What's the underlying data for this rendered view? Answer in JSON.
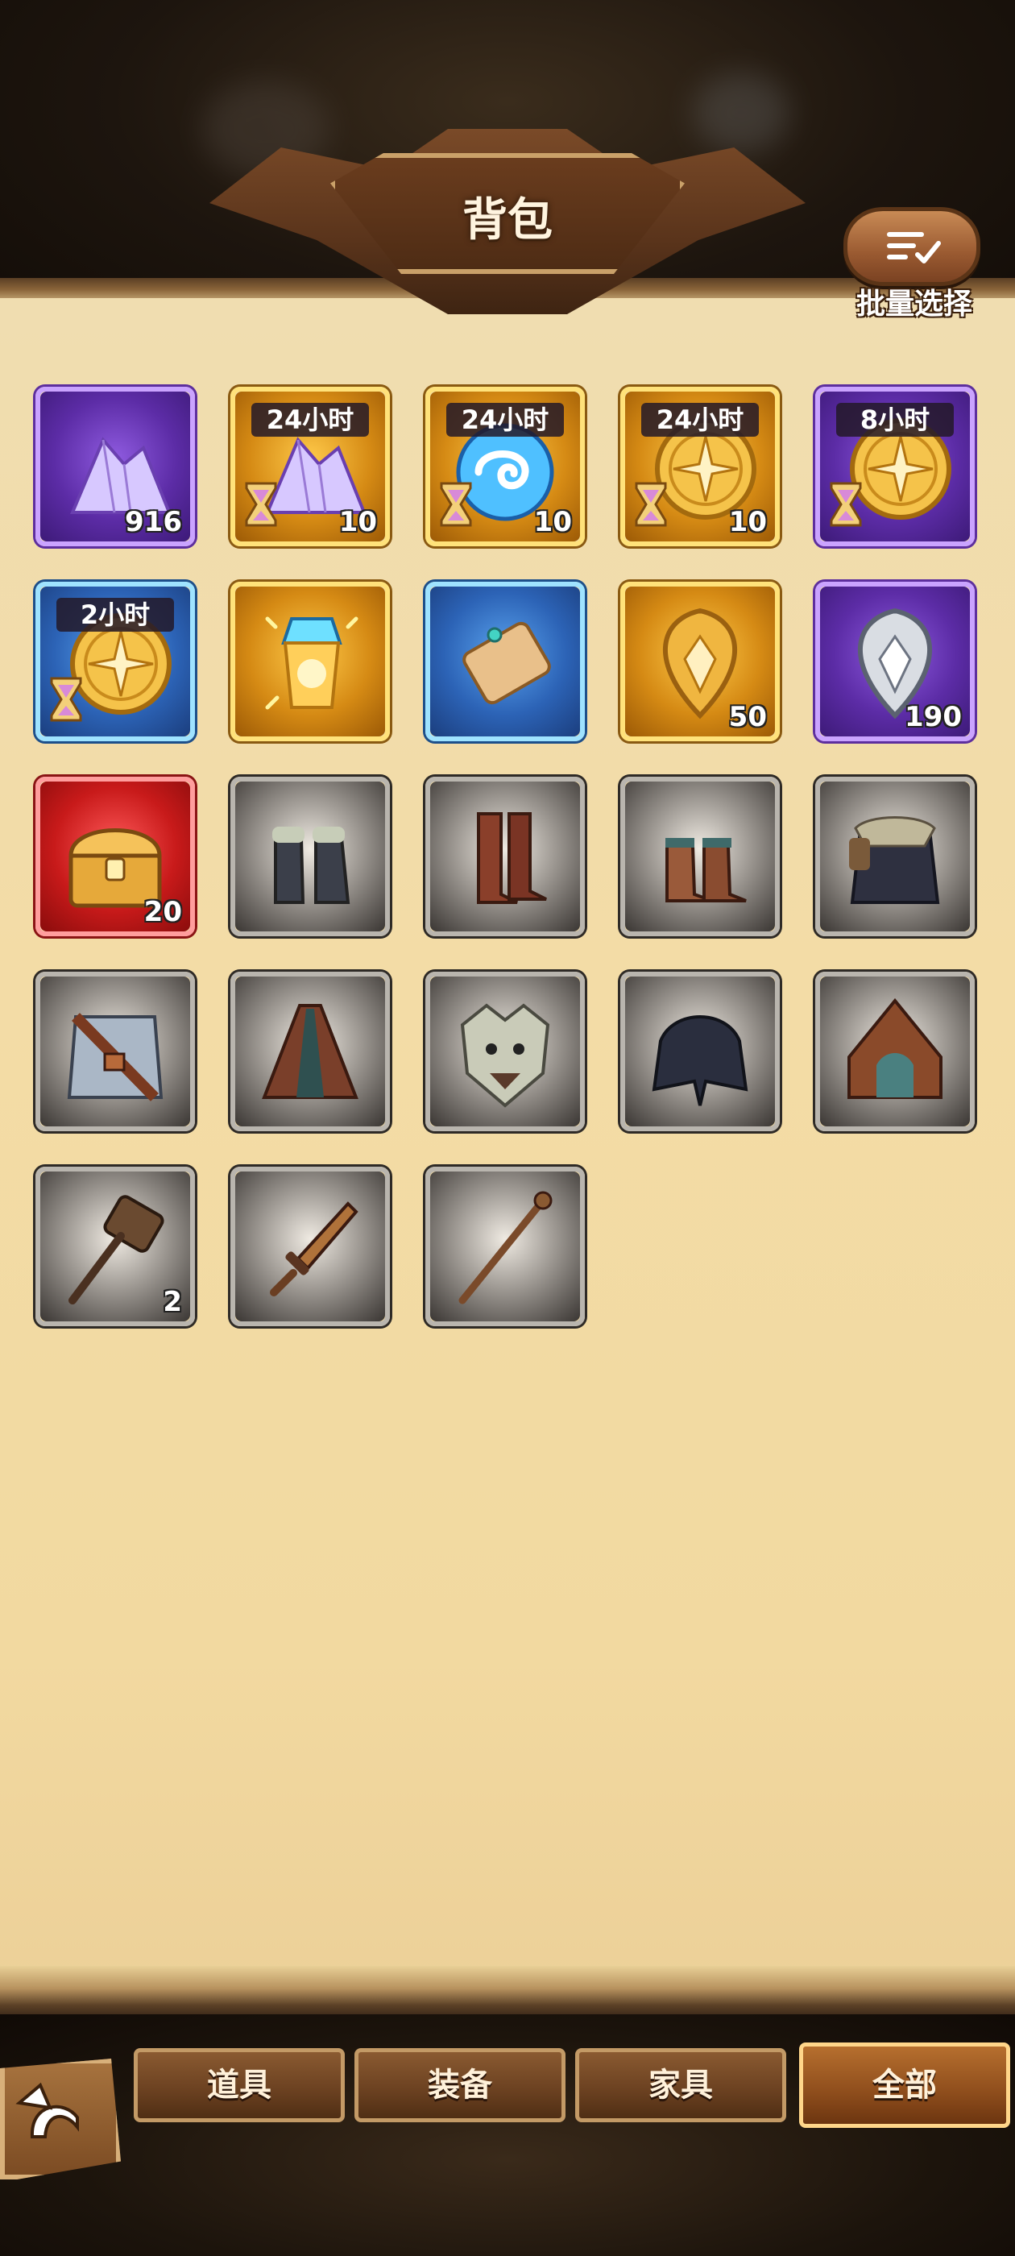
{
  "header": {
    "title": "背包",
    "batch_select_label": "批量选择"
  },
  "inventory": {
    "rows": [
      [
        {
          "name": "purple-crystal",
          "rarity": "purple",
          "timer": "",
          "qty": "916",
          "icon": "purple-crystal-icon"
        },
        {
          "name": "purple-crystal-timed",
          "rarity": "gold",
          "timer": "24小时",
          "qty": "10",
          "icon": "purple-crystal-icon"
        },
        {
          "name": "blue-orb-timed",
          "rarity": "gold",
          "timer": "24小时",
          "qty": "10",
          "icon": "blue-orb-icon"
        },
        {
          "name": "gold-coin-timed",
          "rarity": "gold",
          "timer": "24小时",
          "qty": "10",
          "icon": "gold-coin-icon"
        },
        {
          "name": "gold-coin-timed-8h",
          "rarity": "purple",
          "timer": "8小时",
          "qty": "",
          "icon": "gold-coin-icon"
        }
      ],
      [
        {
          "name": "gold-coin-timed-2h",
          "rarity": "blue",
          "timer": "2小时",
          "qty": "",
          "icon": "gold-coin-icon"
        },
        {
          "name": "magic-lantern",
          "rarity": "gold",
          "timer": "",
          "qty": "",
          "icon": "lantern-icon"
        },
        {
          "name": "scroll",
          "rarity": "blue",
          "timer": "",
          "qty": "",
          "icon": "scroll-icon"
        },
        {
          "name": "gold-crest",
          "rarity": "gold",
          "timer": "",
          "qty": "50",
          "icon": "gold-crest-icon"
        },
        {
          "name": "silver-crest",
          "rarity": "purple",
          "timer": "",
          "qty": "190",
          "icon": "silver-crest-icon"
        }
      ],
      [
        {
          "name": "treasure-chest",
          "rarity": "red",
          "timer": "",
          "qty": "20",
          "icon": "treasure-chest-icon"
        },
        {
          "name": "fur-boots",
          "rarity": "gray",
          "timer": "",
          "qty": "",
          "icon": "fur-boots-icon"
        },
        {
          "name": "tall-boots",
          "rarity": "gray",
          "timer": "",
          "qty": "",
          "icon": "tall-boots-icon"
        },
        {
          "name": "short-boots",
          "rarity": "gray",
          "timer": "",
          "qty": "",
          "icon": "short-boots-icon"
        },
        {
          "name": "fur-armor",
          "rarity": "gray",
          "timer": "",
          "qty": "",
          "icon": "fur-armor-icon"
        }
      ],
      [
        {
          "name": "leather-armor",
          "rarity": "gray",
          "timer": "",
          "qty": "",
          "icon": "leather-armor-icon"
        },
        {
          "name": "brown-cloak",
          "rarity": "gray",
          "timer": "",
          "qty": "",
          "icon": "cloak-icon"
        },
        {
          "name": "wolf-helm",
          "rarity": "gray",
          "timer": "",
          "qty": "",
          "icon": "wolf-helm-icon"
        },
        {
          "name": "dark-scarf",
          "rarity": "gray",
          "timer": "",
          "qty": "",
          "icon": "scarf-icon"
        },
        {
          "name": "brown-hood",
          "rarity": "gray",
          "timer": "",
          "qty": "",
          "icon": "hood-icon"
        }
      ],
      [
        {
          "name": "wooden-hammer",
          "rarity": "gray",
          "timer": "",
          "qty": "2",
          "icon": "hammer-icon"
        },
        {
          "name": "wooden-dagger",
          "rarity": "gray",
          "timer": "",
          "qty": "",
          "icon": "dagger-icon"
        },
        {
          "name": "wooden-staff",
          "rarity": "gray",
          "timer": "",
          "qty": "",
          "icon": "staff-icon"
        }
      ]
    ]
  },
  "tabs": [
    {
      "label": "道具",
      "active": false
    },
    {
      "label": "装备",
      "active": false
    },
    {
      "label": "家具",
      "active": false
    },
    {
      "label": "全部",
      "active": true
    }
  ],
  "back_button": {
    "icon": "back-arrow-icon"
  }
}
